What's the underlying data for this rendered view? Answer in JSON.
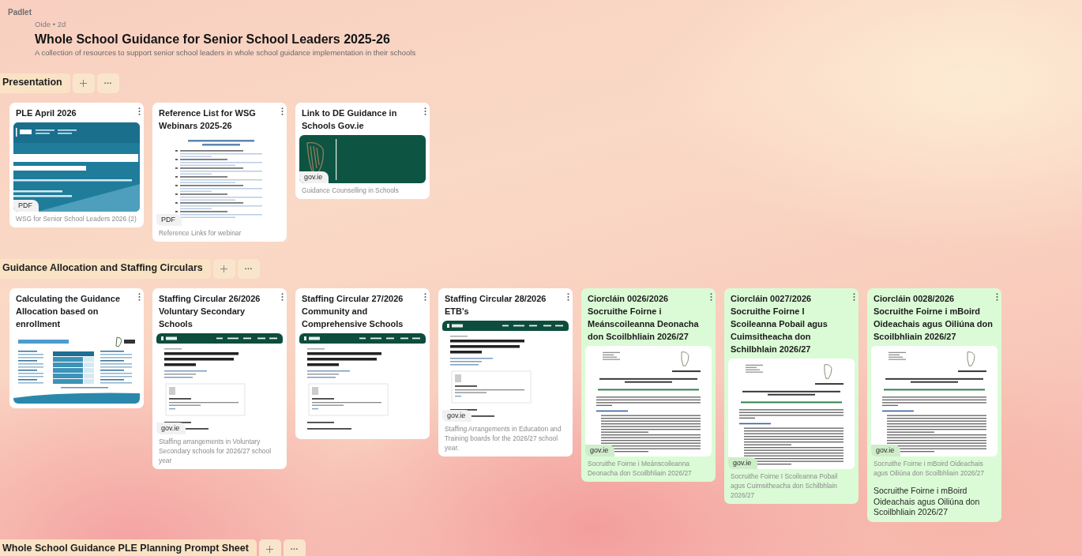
{
  "app": {
    "logo": "Padlet"
  },
  "board": {
    "meta": "Oide • 2d",
    "title": "Whole School Guidance for Senior School Leaders 2025-26",
    "description": "A collection of resources to support senior school leaders in whole school guidance implementation in their schools"
  },
  "sections": [
    {
      "title": "Presentation",
      "posts": [
        {
          "title": "PLE April 2026",
          "color": "#ffffff",
          "preview": {
            "kind": "title-slide",
            "badge": "PDF"
          },
          "caption": "WSG for Senior School Leaders 2026 (2)"
        },
        {
          "title": "Reference List for WSG Webinars 2025-26",
          "color": "#ffffff",
          "preview": {
            "kind": "document",
            "badge": "PDF"
          },
          "caption": "Reference Links for webinar"
        },
        {
          "title": "Link to DE Guidance in Schools Gov.ie",
          "color": "#ffffff",
          "preview": {
            "kind": "logo",
            "badge": "gov.ie"
          },
          "caption": "Guidance Counselling in Schools"
        }
      ]
    },
    {
      "title": "Guidance Allocation and Staffing Circulars",
      "posts": [
        {
          "title": "Calculating the Guidance Allocation based on enrollment",
          "color": "#ffffff",
          "preview": {
            "kind": "chart-slide"
          }
        },
        {
          "title": "Staffing Circular 26/2026 Voluntary Secondary Schools",
          "color": "#ffffff",
          "preview": {
            "kind": "webpage",
            "badge": "gov.ie"
          },
          "caption": "Staffing arrangements in Voluntary Secondary schools for 2026/27 school year"
        },
        {
          "title": "Staffing Circular 27/2026 Community and Comprehensive Schools",
          "color": "#ffffff",
          "preview": {
            "kind": "webpage"
          }
        },
        {
          "title": "Staffing Circular 28/2026 ETB's",
          "color": "#ffffff",
          "preview": {
            "kind": "webpage",
            "badge": "gov.ie"
          },
          "caption": "Staffing Arrangements in Education and Training boards for the 2026/27 school year."
        },
        {
          "title": "Ciorcláin 0026/2026 Socruithe Foirne i Meánscoileanna Deonacha don Scoilbhliain 2026/27",
          "color": "#dbfbd6",
          "preview": {
            "kind": "letter",
            "badge": "gov.ie"
          },
          "caption": "Socruithe Foirne i Meánscoileanna Deonacha don Scoilbhliain 2026/27"
        },
        {
          "title": "Ciorcláin 0027/2026 Socruithe Foirne I Scoileanna Pobail agus Cuimsitheacha don Schilbhlain 2026/27",
          "color": "#dbfbd6",
          "preview": {
            "kind": "letter",
            "badge": "gov.ie"
          },
          "caption": "Socruithe Foirne I Scoileanna Pobail agus Cuimsitheacha don Schilbhlain 2026/27"
        },
        {
          "title": "Ciorcláin 0028/2026 Socruithe Foirne i mBoird Oideachais agus Oiliúna don Scoilbhliain 2026/27",
          "color": "#dbfbd6",
          "preview": {
            "kind": "letter",
            "badge": "gov.ie"
          },
          "caption": "Socruithe Foirne i mBoird Oideachais agus Oiliúna don Scoilbhliain 2026/27",
          "body": "Socruithe Foirne i mBoird Oideachais agus Oiliúna don Scoilbhliain 2026/27"
        }
      ]
    },
    {
      "title": "Whole School Guidance PLE Planning Prompt Sheet"
    }
  ]
}
